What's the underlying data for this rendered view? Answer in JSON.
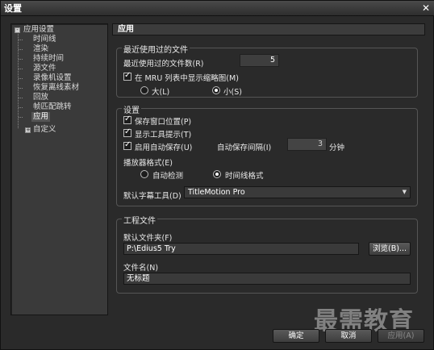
{
  "window": {
    "title": "设置",
    "close_glyph": "✕"
  },
  "tree": {
    "root1": {
      "label": "应用设置",
      "toggle": "-"
    },
    "children": [
      "时间线",
      "渲染",
      "持续时间",
      "源文件",
      "录像机设置",
      "恢复离线素材",
      "回放",
      "帧匹配跳转",
      "应用"
    ],
    "selected": "应用",
    "root2": {
      "label": "自定义",
      "toggle": "+"
    }
  },
  "panel": {
    "title": "应用"
  },
  "recent": {
    "legend": "最近使用过的文件",
    "count_label": "最近使用过的文件数(R)",
    "count_value": "5",
    "thumb_label": "在 MRU 列表中显示缩略图(M)",
    "thumb_checked": true,
    "size_large": "大(L)",
    "size_small": "小(S)",
    "size_selected": "small"
  },
  "settings": {
    "legend": "设置",
    "save_window_pos": "保存窗口位置(P)",
    "show_tooltips": "显示工具提示(T)",
    "autosave": "启用自动保存(U)",
    "autosave_interval_label": "自动保存间隔(I)",
    "autosave_interval_value": "3",
    "autosave_unit": "分钟",
    "player_format_label": "播放器格式(E)",
    "player_auto": "自动检测",
    "player_timecode": "时间线格式",
    "player_selected": "timecode",
    "subtitle_tool_label": "默认字幕工具(D)",
    "subtitle_tool_value": "TitleMotion Pro"
  },
  "project": {
    "legend": "工程文件",
    "folder_label": "默认文件夹(F)",
    "folder_value": "P:\\Edius5 Try",
    "browse_label": "浏览(B)...",
    "filename_label": "文件名(N)",
    "filename_value": "无标题"
  },
  "footer": {
    "ok": "确定",
    "cancel": "取消",
    "apply": "应用(A)"
  },
  "watermark": "最需教育"
}
